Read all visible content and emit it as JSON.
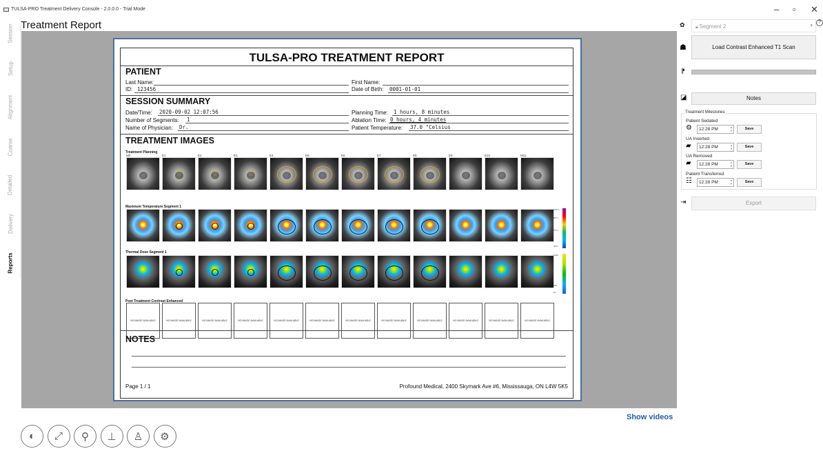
{
  "window": {
    "title": "TULSA-PRO Treatment Delivery Console - 2.0.0.0 - Trial Mode",
    "min_icon": "minimize-icon",
    "max_icon": "maximize-icon",
    "close_icon": "close-icon",
    "min_glyph": "–",
    "max_glyph": "▫",
    "close_glyph": "✕"
  },
  "nav": {
    "tabs": [
      {
        "label": "Session",
        "active": false
      },
      {
        "label": "Setup",
        "active": false
      },
      {
        "label": "Alignment",
        "active": false
      },
      {
        "label": "Coarse",
        "active": false
      },
      {
        "label": "Detailed",
        "active": false
      },
      {
        "label": "Delivery",
        "active": false
      },
      {
        "label": "Reports",
        "active": true
      }
    ]
  },
  "page_title": "Treatment Report",
  "report": {
    "title": "TULSA-PRO TREATMENT REPORT",
    "patient": {
      "heading": "PATIENT",
      "last_name_label": "Last Name:",
      "last_name": "",
      "first_name_label": "First Name:",
      "first_name": "",
      "id_label": "ID:",
      "id": "123456",
      "dob_label": "Date of Birth:",
      "dob": "0001-01-01"
    },
    "session": {
      "heading": "SESSION SUMMARY",
      "datetime_label": "Date/Time:",
      "datetime": "2020-09-02 12:07:56",
      "segments_label": "Number of Segments:",
      "segments": "1",
      "physician_label": "Name of Physician:",
      "physician": "Dr.",
      "planning_label": "Planning Time:",
      "planning": "1 hours, 8 minutes",
      "ablation_label": "Ablation Time:",
      "ablation": "0 hours, 4 minutes",
      "temperature_label": "Patient Temperature:",
      "temperature": "37.0 °Celsius"
    },
    "images": {
      "heading": "TREATMENT IMAGES",
      "columns": [
        "M0",
        "E1",
        "E2",
        "E3",
        "E4",
        "E5",
        "E6",
        "E7",
        "E8",
        "E9",
        "E10",
        "M11"
      ],
      "rows": [
        {
          "label": "Treatment Planning",
          "kind": "mri"
        },
        {
          "label": "Maximum Temperature Segment 1",
          "kind": "temp"
        },
        {
          "label": "Thermal Dose Segment 1",
          "kind": "dose"
        },
        {
          "label": "Post Treatment Contrast Enhanced",
          "kind": "noimg"
        }
      ],
      "no_image_text": "NO IMAGE AVAILABLE",
      "temp_scale": {
        "top": "100°C",
        "upper": "80°C",
        "mid": "57°C",
        "low": "30°C"
      },
      "dose_scale": {
        "top": "1000",
        "mid": "240",
        "low": "10"
      },
      "colors": {
        "frame": "#4a6f9e",
        "contour": "#d9a21b"
      }
    },
    "notes_heading": "NOTES",
    "footer_page": "Page 1 / 1",
    "footer_address": "Profound Medical, 2400 Skymark Ave #6, Mississauga, ON L4W 5K5"
  },
  "panel": {
    "segment_select": "Segment 2",
    "load_button": "Load Contrast Enhanced T1 Scan",
    "notes_button": "Notes",
    "progress": 0,
    "milestones": {
      "title": "Treatment Milestones",
      "items": [
        {
          "label": "Patient Sedated",
          "time": "12:28 PM",
          "save": "Save",
          "icon": "syringe-icon"
        },
        {
          "label": "UA Inserted",
          "time": "12:28 PM",
          "save": "Save",
          "icon": "insert-icon"
        },
        {
          "label": "UA Removed",
          "time": "12:28 PM",
          "save": "Save",
          "icon": "remove-icon"
        },
        {
          "label": "Patient Transferred",
          "time": "12:28 PM",
          "save": "Save",
          "icon": "bed-icon"
        }
      ]
    },
    "export_button": "Export",
    "show_videos": "Show videos"
  },
  "bottom_icons": [
    {
      "name": "mri-scanner-icon",
      "glyph": "◐"
    },
    {
      "name": "patient-table-icon",
      "glyph": "⤢"
    },
    {
      "name": "catheter-icon",
      "glyph": "⚲"
    },
    {
      "name": "treatment-device-icon",
      "glyph": "⊥"
    },
    {
      "name": "patient-body-icon",
      "glyph": "♙"
    },
    {
      "name": "settings-gear-icon",
      "glyph": "⚙"
    }
  ]
}
